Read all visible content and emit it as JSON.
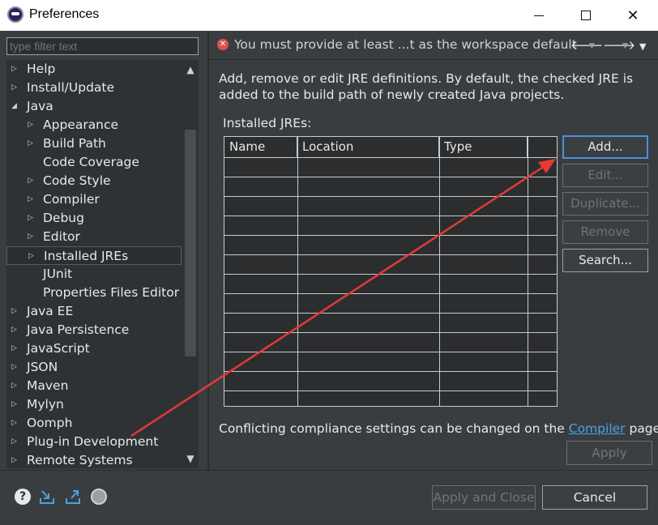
{
  "window": {
    "title": "Preferences",
    "min_icon": "minimize-icon",
    "max_icon": "maximize-icon",
    "close_glyph": "✕"
  },
  "filter": {
    "placeholder": "type filter text"
  },
  "tree": {
    "items": [
      {
        "label": "Help",
        "level": 0,
        "twisty": "collapsed"
      },
      {
        "label": "Install/Update",
        "level": 0,
        "twisty": "collapsed"
      },
      {
        "label": "Java",
        "level": 0,
        "twisty": "expanded"
      },
      {
        "label": "Appearance",
        "level": 1,
        "twisty": "collapsed"
      },
      {
        "label": "Build Path",
        "level": 1,
        "twisty": "collapsed"
      },
      {
        "label": "Code Coverage",
        "level": 1,
        "twisty": "none"
      },
      {
        "label": "Code Style",
        "level": 1,
        "twisty": "collapsed"
      },
      {
        "label": "Compiler",
        "level": 1,
        "twisty": "collapsed"
      },
      {
        "label": "Debug",
        "level": 1,
        "twisty": "collapsed"
      },
      {
        "label": "Editor",
        "level": 1,
        "twisty": "collapsed"
      },
      {
        "label": "Installed JREs",
        "level": 1,
        "twisty": "collapsed",
        "selected": true
      },
      {
        "label": "JUnit",
        "level": 1,
        "twisty": "none"
      },
      {
        "label": "Properties Files Editor",
        "level": 1,
        "twisty": "none"
      },
      {
        "label": "Java EE",
        "level": 0,
        "twisty": "collapsed"
      },
      {
        "label": "Java Persistence",
        "level": 0,
        "twisty": "collapsed"
      },
      {
        "label": "JavaScript",
        "level": 0,
        "twisty": "collapsed"
      },
      {
        "label": "JSON",
        "level": 0,
        "twisty": "collapsed"
      },
      {
        "label": "Maven",
        "level": 0,
        "twisty": "collapsed"
      },
      {
        "label": "Mylyn",
        "level": 0,
        "twisty": "collapsed"
      },
      {
        "label": "Oomph",
        "level": 0,
        "twisty": "collapsed"
      },
      {
        "label": "Plug-in Development",
        "level": 0,
        "twisty": "collapsed"
      },
      {
        "label": "Remote Systems",
        "level": 0,
        "twisty": "collapsed"
      }
    ]
  },
  "error": {
    "icon": "error-icon",
    "message": "You must provide at least ...t as the workspace default"
  },
  "nav": {
    "back": "🡐",
    "forward": "🡒",
    "menu": "▼"
  },
  "page": {
    "description": "Add, remove or edit JRE definitions. By default, the checked JRE is added to the build path of newly created Java projects.",
    "installed_label": "Installed JREs:",
    "columns": [
      "Name",
      "Location",
      "Type"
    ]
  },
  "buttons": {
    "add": "Add...",
    "edit": "Edit...",
    "duplicate": "Duplicate...",
    "remove": "Remove",
    "search": "Search..."
  },
  "compliance": {
    "prefix": "Conflicting compliance settings can be changed on the ",
    "link": "Compiler",
    "suffix": " page."
  },
  "apply": "Apply",
  "footer": {
    "apply_close": "Apply and Close",
    "cancel": "Cancel"
  },
  "annotation": {
    "arrow_color": "#e53935"
  }
}
